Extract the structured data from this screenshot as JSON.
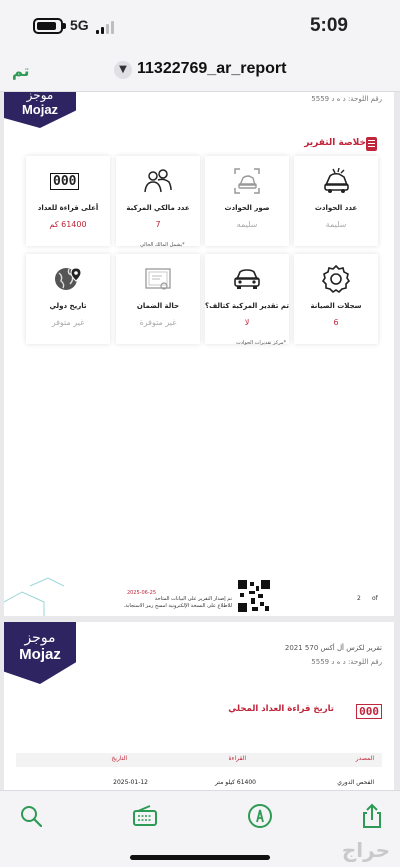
{
  "status_bar": {
    "network": "5G",
    "time": "5:09"
  },
  "nav": {
    "done_label": "تم",
    "document_title": "11322769_ar_report"
  },
  "logo": {
    "arabic": "موجز",
    "english": "Mojaz"
  },
  "page1": {
    "plate_label": "رقم اللوحة:",
    "plate_value": "د ه د 5559",
    "section_title": "خلاصة التقرير",
    "tiles": [
      {
        "icon": "crashed-car-icon",
        "label": "عدد الحوادث",
        "value": "سليمة",
        "muted": true
      },
      {
        "icon": "accident-photo-icon",
        "label": "صور الحوادث",
        "value": "سليمه",
        "muted": true
      },
      {
        "icon": "owners-icon",
        "label": "عدد مالكي المركبة",
        "value": "7",
        "muted": false
      },
      {
        "icon": "odometer-icon",
        "label": "أعلى قراءة للعداد",
        "value": "61400 كم",
        "muted": false
      },
      {
        "icon": "gear-icon",
        "label": "سجلات الصيانة",
        "value": "6",
        "muted": false
      },
      {
        "icon": "car-icon",
        "label": "تم تقدير المركبة كتالف؟",
        "value": "لا",
        "muted": false
      },
      {
        "icon": "certificate-icon",
        "label": "حالة الضمان",
        "value": "غير متوفرة",
        "muted": true
      },
      {
        "icon": "globe-pin-icon",
        "label": "تاريخ دولي",
        "value": "غير متوفر",
        "muted": true
      }
    ],
    "owners_note": "*يشمل المالك الحالي",
    "loss_note": "*مركز تقديرات الحوادث",
    "odometer_icon_text": "000",
    "footer_date": "2025-06-25",
    "footer_line1": "تم إصدار التقرير على البيانات المتاحة",
    "footer_line2": "للاطلاع على النسخة الإلكترونية امسح رمز الاستجابة.",
    "page_number": "2",
    "page_of": "of"
  },
  "page2": {
    "car_label": "تقرير لكزس أل أكس 570 2021",
    "plate_label": "رقم اللوحة:",
    "plate_value": "د ه د 5559",
    "section_title": "تاريخ قراءة العداد المحلي",
    "odometer_icon_text": "000",
    "table_headers": {
      "source": "المصدر",
      "reading": "القراءة",
      "date": "التاريخ"
    },
    "rows": [
      {
        "source": "الفحص الدوري",
        "reading": "61400 كيلو متر",
        "date": "2025-01-12"
      }
    ]
  },
  "toolbar": {
    "search": "search-icon",
    "radio": "radio-icon",
    "markup": "markup-pen-icon",
    "share": "share-icon"
  },
  "watermark": "حراج",
  "colors": {
    "accent": "#c0253a",
    "brand": "#2e2462",
    "done": "#2d9a55"
  }
}
